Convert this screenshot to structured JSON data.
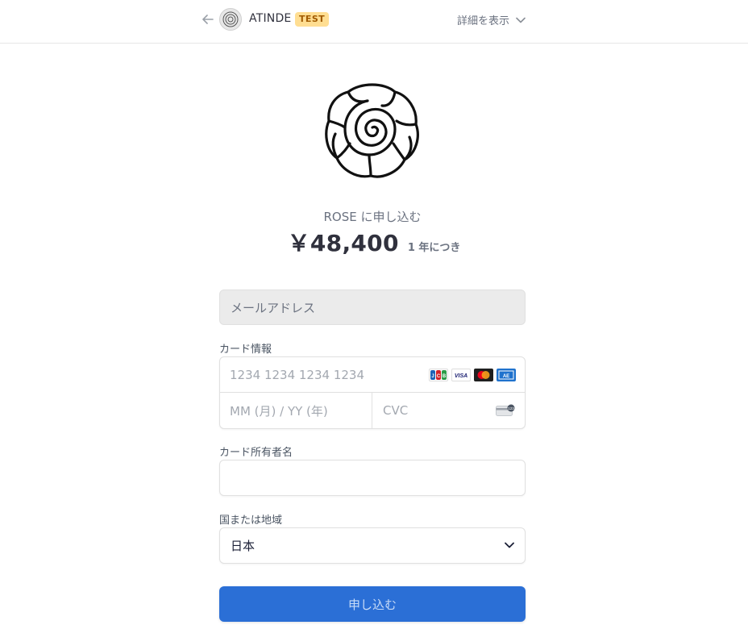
{
  "header": {
    "back_icon": "arrow-left-icon",
    "brand_name": "ATINDE",
    "test_badge": "TEST",
    "details_label": "詳細を表示",
    "details_icon": "chevron-down-icon"
  },
  "product": {
    "title": "ROSE に申し込む",
    "price": "￥48,400",
    "period": "1 年につき",
    "image_icon": "rose-icon"
  },
  "form": {
    "email_placeholder": "メールアドレス",
    "card_label": "カード情報",
    "card_number_placeholder": "1234 1234 1234 1234",
    "card_brands": [
      "JCB",
      "VISA",
      "Mastercard",
      "American Express"
    ],
    "expiry_placeholder": "MM (月) / YY (年)",
    "cvc_placeholder": "CVC",
    "cardholder_label": "カード所有者名",
    "cardholder_value": "",
    "country_label": "国または地域",
    "country_value": "日本",
    "submit_label": "申し込む"
  },
  "colors": {
    "accent": "#2b6fd6",
    "badge_bg": "#ffde92",
    "badge_text": "#a05a00"
  }
}
